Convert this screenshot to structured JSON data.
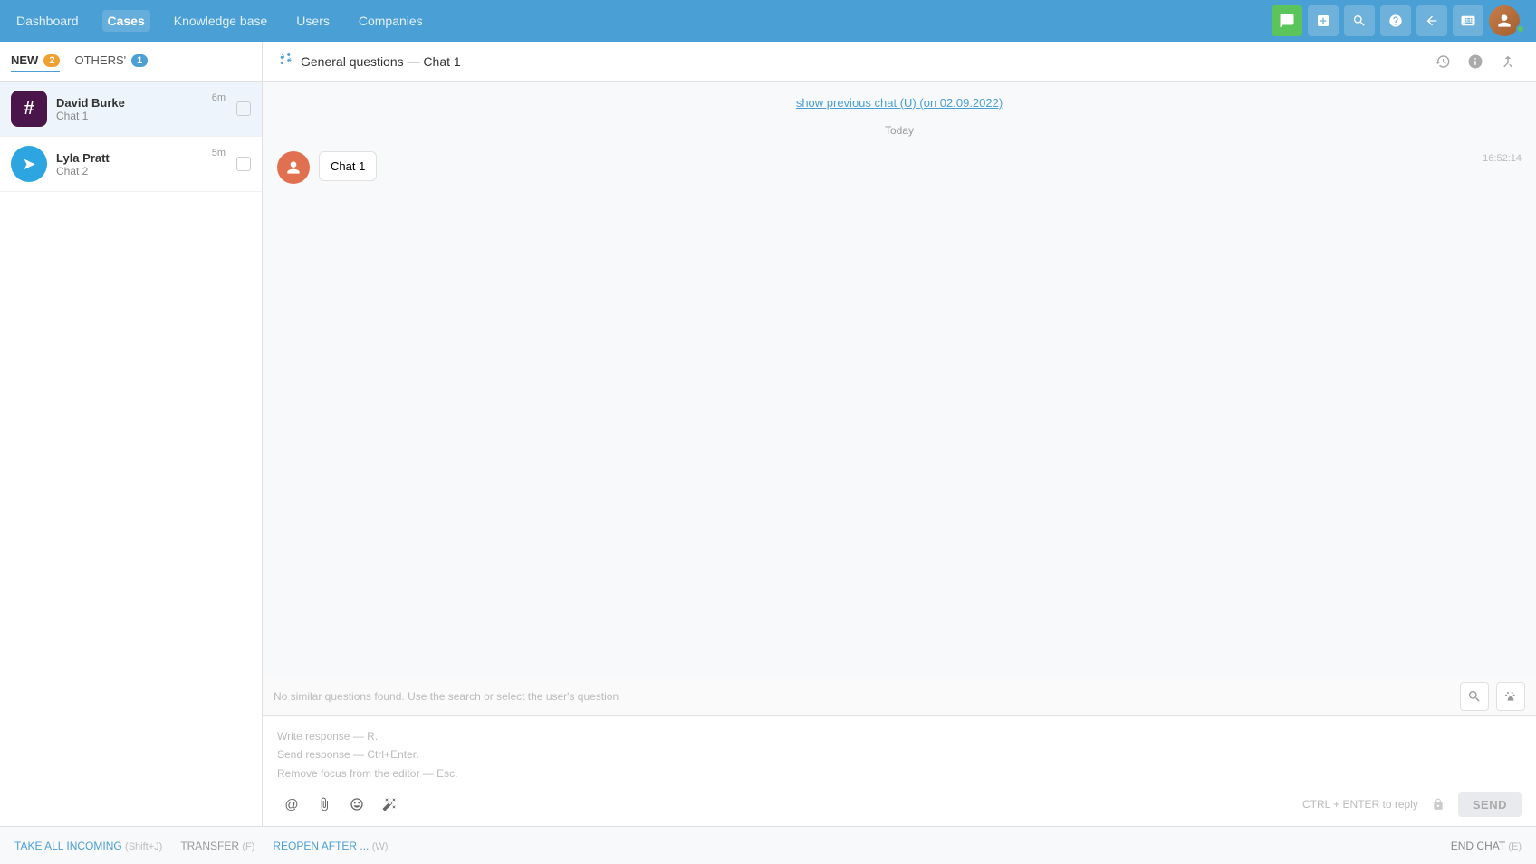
{
  "nav": {
    "items": [
      {
        "label": "Dashboard",
        "active": false
      },
      {
        "label": "Cases",
        "active": true
      },
      {
        "label": "Knowledge base",
        "active": false
      },
      {
        "label": "Users",
        "active": false
      },
      {
        "label": "Companies",
        "active": false
      }
    ]
  },
  "sidebar": {
    "tabs": [
      {
        "label": "NEW",
        "count": "2",
        "active": true
      },
      {
        "label": "OTHERS'",
        "count": "1",
        "active": false
      }
    ],
    "chats": [
      {
        "name": "David Burke",
        "sub": "Chat 1",
        "time": "6m",
        "avatarType": "slack",
        "active": true
      },
      {
        "name": "Lyla Pratt",
        "sub": "Chat 2",
        "time": "5m",
        "avatarType": "telegram",
        "active": false
      }
    ]
  },
  "chatHeader": {
    "breadcrumb": "General questions — Chat 1",
    "title": "General questions",
    "separator": "—",
    "chat": "Chat 1"
  },
  "messages": {
    "prevChatText": "show previous chat (U)",
    "prevChatDate": "(on 02.09.2022)",
    "dateDivider": "Today",
    "items": [
      {
        "sender": "Chat 1",
        "time": "16:52:14",
        "avatarIcon": "👤"
      }
    ]
  },
  "suggestions": {
    "placeholder": "No similar questions found. Use the search or select the user's question"
  },
  "responseArea": {
    "hint1": "Write response — R.",
    "hint2": "Send response — Ctrl+Enter.",
    "hint3": "Remove focus from the editor — Esc.",
    "sendHint": "CTRL + ENTER to reply",
    "sendLabel": "SEND"
  },
  "bottomBar": {
    "takeAll": "TAKE ALL INCOMING",
    "takeAllKey": "(Shift+J)",
    "transfer": "TRANSFER",
    "transferKey": "(F)",
    "reopen": "REOPEN AFTER ...",
    "reopenKey": "(W)",
    "endChat": "END CHAT",
    "endChatKey": "(E)"
  }
}
